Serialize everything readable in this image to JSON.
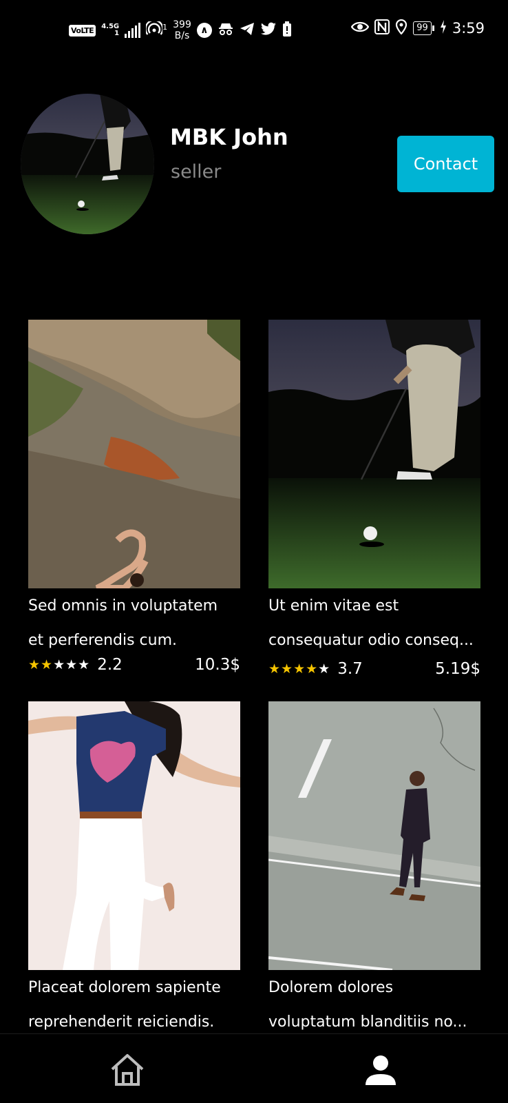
{
  "status_bar": {
    "volte": "VoLTE",
    "network": "4.5G",
    "sim": "1",
    "hotspot_count": "1",
    "speed_value": "399",
    "speed_unit": "B/s",
    "battery": "99",
    "time": "3:59"
  },
  "profile": {
    "name": "MBK John",
    "role": "seller",
    "contact_label": "Contact"
  },
  "products": [
    {
      "title_line1": "Sed omnis in voluptatem",
      "title_line2": "et perferendis cum.",
      "rating_value": 2.2,
      "rating": "2.2",
      "price": "10.3$"
    },
    {
      "title_line1": "Ut enim vitae est",
      "title_line2": "consequatur odio conseq...",
      "rating_value": 3.7,
      "rating": "3.7",
      "price": "5.19$"
    },
    {
      "title_line1": "Placeat dolorem sapiente",
      "title_line2": "reprehenderit reiciendis."
    },
    {
      "title_line1": "Dolorem dolores",
      "title_line2": "voluptatum blanditiis no..."
    }
  ],
  "bottom_nav": {
    "items": [
      {
        "icon": "home-icon"
      },
      {
        "icon": "person-icon",
        "active": true
      }
    ]
  },
  "colors": {
    "background": "#000000",
    "accent": "#00b4d4",
    "star": "#f5c400",
    "muted_text": "#8a8a8a"
  }
}
